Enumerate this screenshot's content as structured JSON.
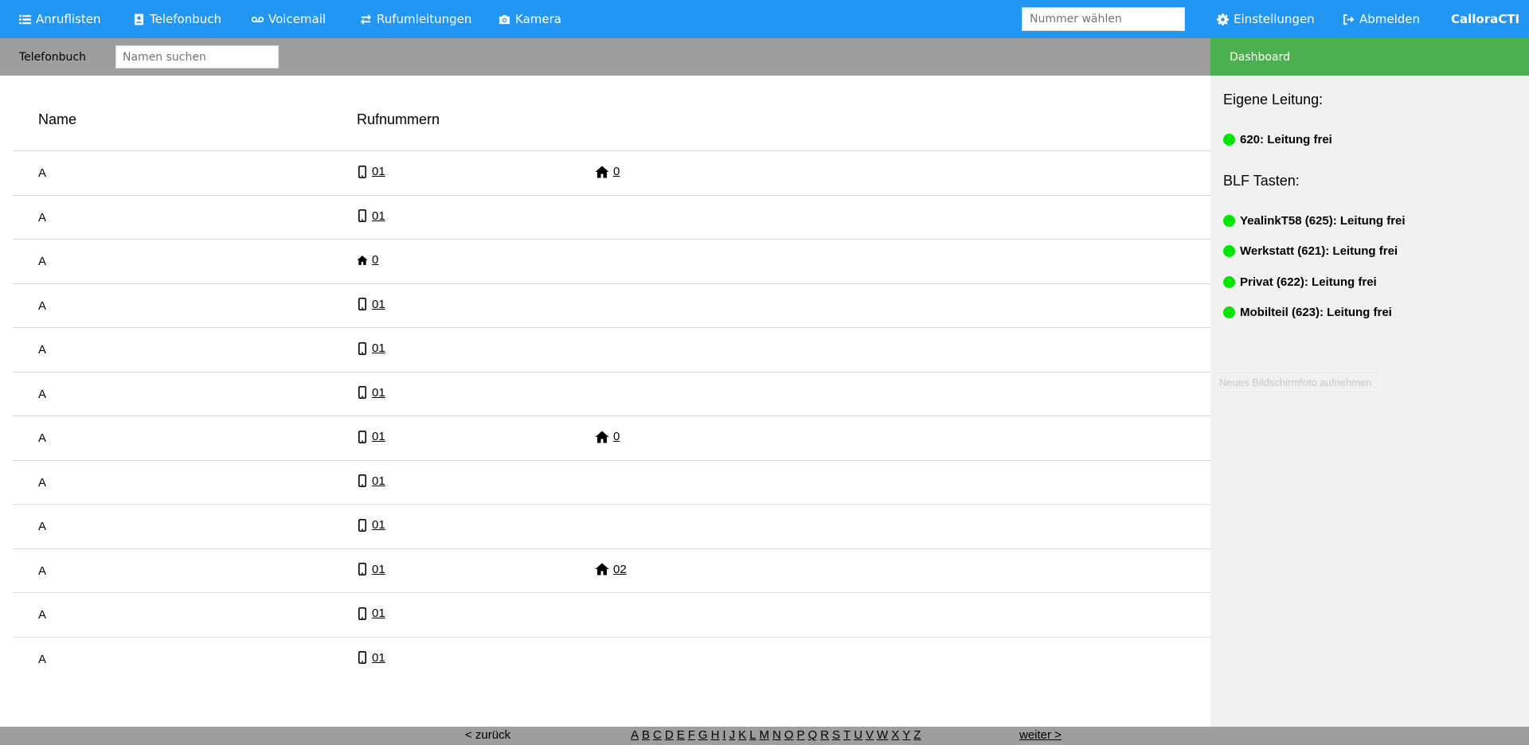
{
  "nav": {
    "items": [
      {
        "label": "Anruflisten",
        "icon": "list-icon"
      },
      {
        "label": "Telefonbuch",
        "icon": "address-book-icon"
      },
      {
        "label": "Voicemail",
        "icon": "voicemail-icon"
      },
      {
        "label": "Rufumleitungen",
        "icon": "forward-icon"
      },
      {
        "label": "Kamera",
        "icon": "camera-icon"
      }
    ],
    "dial_placeholder": "Nummer wählen",
    "settings_label": "Einstellungen",
    "logout_label": "Abmelden",
    "brand": "CalloraCTI"
  },
  "colors": {
    "nav": "#2196F3",
    "dashboard_tab": "#4CAF50",
    "status_free": "#00e600",
    "bar": "#9e9e9e"
  },
  "subbar": {
    "title": "Telefonbuch",
    "search_placeholder": "Namen suchen"
  },
  "dashboard": {
    "tab_label": "Dashboard",
    "own_line_heading": "Eigene Leitung:",
    "own_line": "620: Leitung frei",
    "blf_heading": "BLF Tasten:",
    "blf": [
      "YealinkT58 (625): Leitung frei",
      "Werkstatt (621): Leitung frei",
      "Privat (622): Leitung frei",
      "Mobilteil (623): Leitung frei"
    ],
    "screenshot_hint": "Neues Bildschirmfoto aufnehmen"
  },
  "table": {
    "headers": {
      "name": "Name",
      "numbers": "Rufnummern"
    },
    "rows": [
      {
        "name": "A",
        "mobile": "01",
        "home": "0"
      },
      {
        "name": "A",
        "mobile": "01",
        "home": null
      },
      {
        "name": "A",
        "mobile": null,
        "home": "0"
      },
      {
        "name": "A",
        "mobile": "01",
        "home": null
      },
      {
        "name": "A",
        "mobile": "01",
        "home": null
      },
      {
        "name": "A",
        "mobile": "01",
        "home": null
      },
      {
        "name": "A",
        "mobile": "01",
        "home": "0"
      },
      {
        "name": "A",
        "mobile": "01",
        "home": null
      },
      {
        "name": "A",
        "mobile": "01",
        "home": null
      },
      {
        "name": "A",
        "mobile": "01",
        "home": "02"
      },
      {
        "name": "A",
        "mobile": "01",
        "home": null
      },
      {
        "name": "A",
        "mobile": "01",
        "home": null
      }
    ]
  },
  "pagination": {
    "prev": "< zurück",
    "next": "weiter >",
    "letters": [
      "A",
      "B",
      "C",
      "D",
      "E",
      "F",
      "G",
      "H",
      "I",
      "J",
      "K",
      "L",
      "M",
      "N",
      "O",
      "P",
      "Q",
      "R",
      "S",
      "T",
      "U",
      "V",
      "W",
      "X",
      "Y",
      "Z"
    ]
  }
}
